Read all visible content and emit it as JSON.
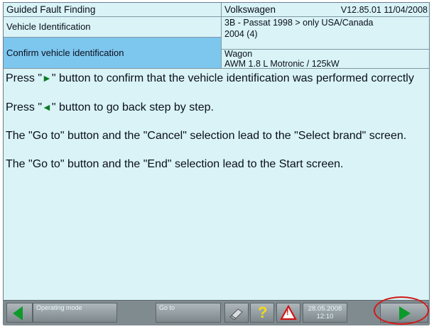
{
  "header": {
    "left": {
      "title": "Guided Fault Finding",
      "subtitle": "Vehicle Identification",
      "step": "Confirm vehicle identification"
    },
    "right": {
      "brand": "Volkswagen",
      "version": "V12.85.01 11/04/2008",
      "model": "3B - Passat 1998 > only USA/Canada",
      "year": "2004 (4)",
      "body": "Wagon",
      "engine": "AWM 1.8 L Motronic / 125kW"
    }
  },
  "content": {
    "p1_pre": "Press \"",
    "p1_post": "\" button to confirm that the vehicle identification was performed correctly",
    "p2_pre": "Press \"",
    "p2_post": "\" button to go back step by step.",
    "p3": "The \"Go to\" button and the \"Cancel\" selection lead to the \"Select brand\" screen.",
    "p4": "The \"Go to\" button and the \"End\" selection lead to the Start screen.",
    "arrow_right": "►",
    "arrow_left": "◄"
  },
  "toolbar": {
    "operating_mode": "Operating mode",
    "goto": "Go to",
    "help": "?",
    "warning": "!",
    "date": "28.05.2008",
    "time": "12:10"
  },
  "colors": {
    "background": "#d9f3f6",
    "highlight": "#7dc6ee",
    "toolbar": "#808b90",
    "arrow": "#0d9a2a",
    "annotation": "#d21919"
  },
  "icons": {
    "back": "back-arrow-icon",
    "forward": "forward-arrow-icon",
    "eraser": "eraser-icon",
    "help": "help-question-icon",
    "warning": "warning-triangle-icon"
  }
}
